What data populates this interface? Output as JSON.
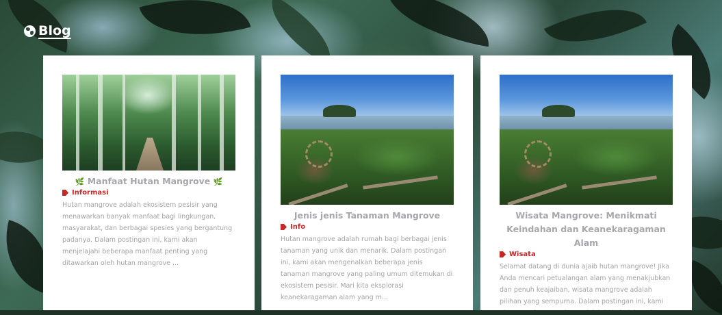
{
  "header": {
    "icon": "globe-icon",
    "title": "Blog"
  },
  "posts": [
    {
      "title": "Manfaat Hutan Mangrove",
      "category": "Informasi",
      "excerpt": "Hutan mangrove adalah ekosistem pesisir yang menawarkan banyak manfaat bagi lingkungan, masyarakat, dan berbagai spesies yang bergantung padanya. Dalam postingan ini, kami akan menjelajahi beberapa manfaat penting yang ditawarkan oleh hutan mangrove ..."
    },
    {
      "title": "Jenis jenis Tanaman Mangrove",
      "category": "Info",
      "excerpt": "Hutan mangrove adalah rumah bagi berbagai jenis tanaman yang unik dan menarik. Dalam postingan ini, kami akan mengenalkan beberapa jenis tanaman mangrove yang paling umum ditemukan di ekosistem pesisir. Mari kita eksplorasi keanekaragaman alam yang m..."
    },
    {
      "title": "Wisata Mangrove: Menikmati Keindahan dan Keanekaragaman Alam",
      "category": "Wisata",
      "excerpt": "Selamat datang di dunia ajaib hutan mangrove! Jika Anda mencari petualangan alam yang menakjubkan dan penuh keajaiban, wisata mangrove adalah pilihan yang sempurna. Dalam postingan ini, kami akan membawa Anda menjelajahi keindahan dan keunikan wisata..."
    }
  ],
  "colors": {
    "category": "#c62828",
    "title": "#a6a6ad",
    "excerpt": "#a3a3a3",
    "sprout": "#9ccc65"
  }
}
